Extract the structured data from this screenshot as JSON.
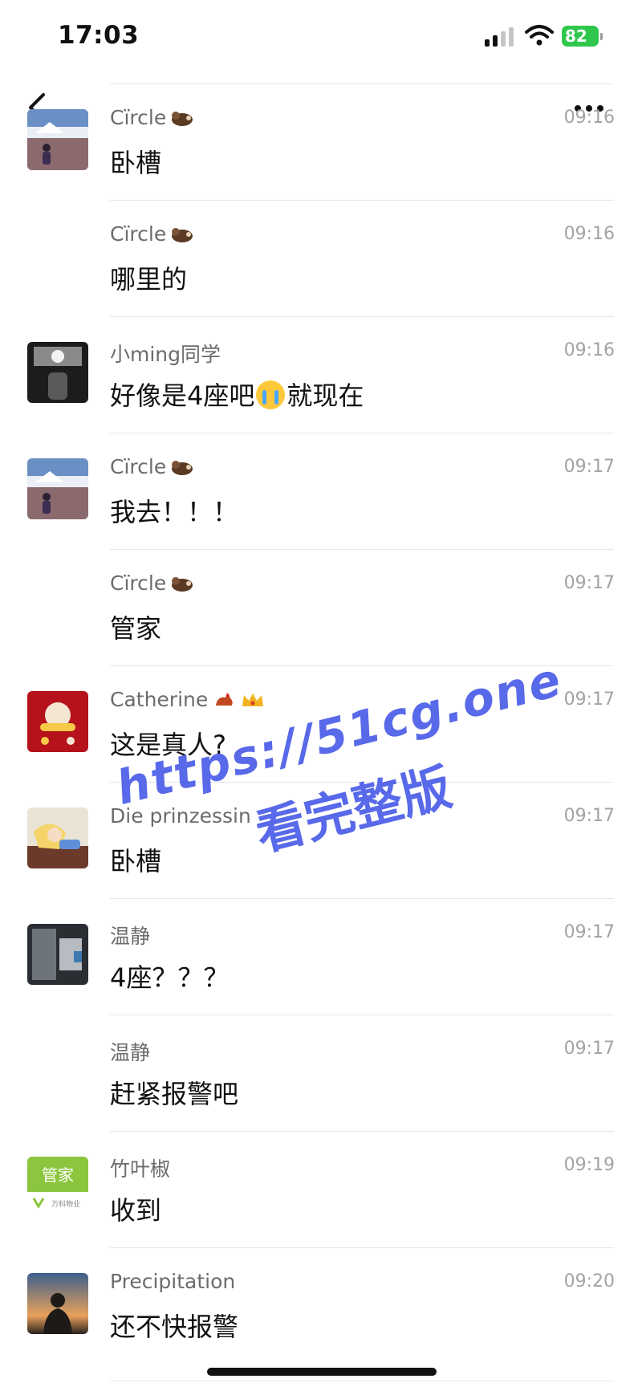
{
  "status_bar": {
    "time": "17:03",
    "battery": "82"
  },
  "messages": [
    {
      "name": "Cïrcle",
      "time": "09:16",
      "text": "卧槽",
      "avatar": "mountain-photo"
    },
    {
      "name": "Cïrcle",
      "time": "09:16",
      "text": "哪里的",
      "avatar": ""
    },
    {
      "name": "小ming同学",
      "time": "09:16",
      "text": "好像是4座吧",
      "text_after": "就现在",
      "avatar": "dark-photo"
    },
    {
      "name": "Cïrcle",
      "time": "09:17",
      "text": "我去！！！",
      "avatar": "mountain-photo"
    },
    {
      "name": "Cïrcle",
      "time": "09:17",
      "text": "管家",
      "avatar": ""
    },
    {
      "name": "Catherine",
      "time": "09:17",
      "text": "这是真人?",
      "avatar": "red-card"
    },
    {
      "name": "Die prinzessin",
      "time": "09:17",
      "text": "卧槽",
      "avatar": "cartoon-girl"
    },
    {
      "name": "温静",
      "time": "09:17",
      "text": "4座？？？",
      "avatar": "grey-photo"
    },
    {
      "name": "温静",
      "time": "09:17",
      "text": "赶紧报警吧",
      "avatar": ""
    },
    {
      "name": "竹叶椒",
      "time": "09:19",
      "text": "收到",
      "avatar": "green-logo"
    },
    {
      "name": "Precipitation",
      "time": "09:20",
      "text": "还不快报警",
      "avatar": "sunset-silhouette"
    }
  ],
  "avatar_labels": {
    "green_logo_text": "管家",
    "green_logo_sub": "万科物业"
  },
  "watermark": {
    "line1": "https://51cg.one",
    "line2": "看完整版"
  },
  "colors": {
    "name_gray": "#6c6c6c",
    "time_gray": "#a3a3a3",
    "battery_green": "#2fc84d",
    "watermark_blue": "#3b4fe6"
  }
}
